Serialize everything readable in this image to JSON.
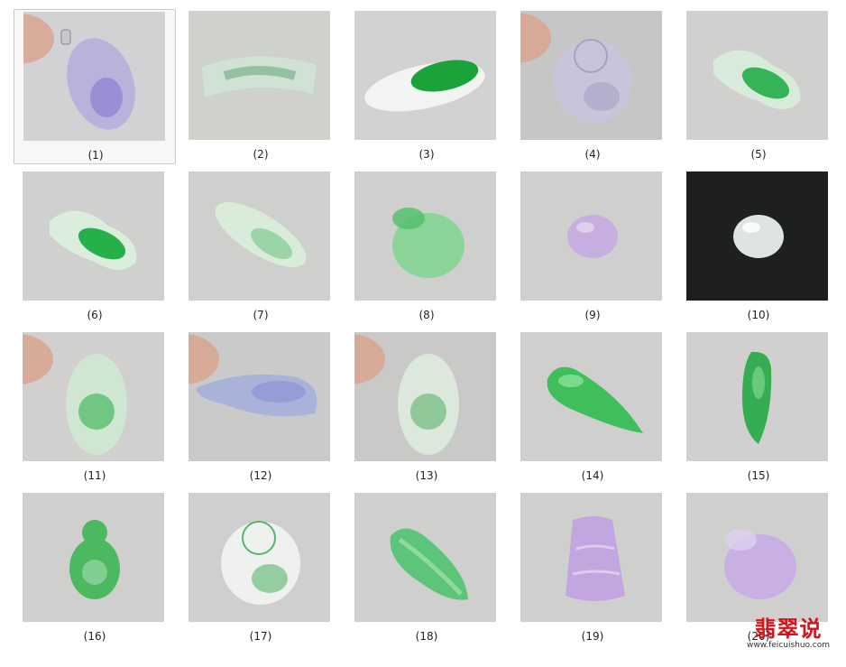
{
  "items": [
    {
      "caption": "(1)",
      "icon": "lavender-pendant-image",
      "bg": "#d2d2d4",
      "color": "#b9b3dc",
      "hl": "#8e7fd0",
      "shape": "pendant-bail",
      "hand": true,
      "selected": true
    },
    {
      "caption": "(2)",
      "icon": "green-bangle-bar-image",
      "bg": "#cfd1cd",
      "color": "#cfe2d4",
      "hl": "#7fb08d",
      "shape": "curved-bar",
      "hand": false,
      "selected": false
    },
    {
      "caption": "(3)",
      "icon": "green-carved-pendant-image",
      "bg": "#d2d2d2",
      "color": "#f2f4f1",
      "hl": "#1aa33a",
      "shape": "long-oval",
      "hand": false,
      "selected": false
    },
    {
      "caption": "(4)",
      "icon": "lavender-buddha-image",
      "bg": "#c7c6c6",
      "color": "#c9c4d9",
      "hl": "#a8a1c7",
      "shape": "round-buddha",
      "hand": true,
      "selected": false
    },
    {
      "caption": "(5)",
      "icon": "green-peapod-image",
      "bg": "#d0d0ce",
      "color": "#d8ead9",
      "hl": "#35b457",
      "shape": "peapod",
      "hand": false,
      "selected": false
    },
    {
      "caption": "(6)",
      "icon": "green-peapod-image",
      "bg": "#d0d0ce",
      "color": "#dbeedd",
      "hl": "#26b04a",
      "shape": "peapod",
      "hand": false,
      "selected": false
    },
    {
      "caption": "(7)",
      "icon": "green-carved-pendant-image",
      "bg": "#cfcfcd",
      "color": "#d9ecd9",
      "hl": "#72c487",
      "shape": "long-oval-tilt",
      "hand": false,
      "selected": false
    },
    {
      "caption": "(8)",
      "icon": "green-ruyi-pendant-image",
      "bg": "#cfcfcd",
      "color": "#8ad49a",
      "hl": "#4fbf68",
      "shape": "drop-round",
      "hand": false,
      "selected": false
    },
    {
      "caption": "(9)",
      "icon": "lavender-cabochon-image",
      "bg": "#cfcfce",
      "color": "#c7aee0",
      "hl": "#e4d8f0",
      "shape": "oval-small",
      "hand": false,
      "selected": false
    },
    {
      "caption": "(10)",
      "icon": "icy-cabochon-image",
      "bg": "#1d1f21",
      "color": "#dfe3e3",
      "hl": "#ffffff",
      "shape": "oval-small",
      "hand": false,
      "selected": false
    },
    {
      "caption": "(11)",
      "icon": "green-buddha-image",
      "bg": "#d1d0ce",
      "color": "#cfe6d2",
      "hl": "#48b95e",
      "shape": "tall-buddha",
      "hand": true,
      "selected": false
    },
    {
      "caption": "(12)",
      "icon": "lavender-carving-image",
      "bg": "#cacaca",
      "color": "#a9b2d9",
      "hl": "#8a8fd4",
      "shape": "long-horizontal",
      "hand": true,
      "selected": false
    },
    {
      "caption": "(13)",
      "icon": "green-carving-image",
      "bg": "#c9cac8",
      "color": "#dce8dc",
      "hl": "#6db97c",
      "shape": "tall-buddha",
      "hand": true,
      "selected": false
    },
    {
      "caption": "(14)",
      "icon": "green-teardrop-image",
      "bg": "#cfcfcd",
      "color": "#3fbf5c",
      "hl": "#8be29a",
      "shape": "teardrop",
      "hand": false,
      "selected": false
    },
    {
      "caption": "(15)",
      "icon": "green-pepper-pendant-image",
      "bg": "#d0d0ce",
      "color": "#35ad52",
      "hl": "#7fd690",
      "shape": "pepper",
      "hand": false,
      "selected": false
    },
    {
      "caption": "(16)",
      "icon": "green-small-buddha-image",
      "bg": "#cfcfcd",
      "color": "#4cb85f",
      "hl": "#8fd59c",
      "shape": "small-buddha",
      "hand": false,
      "selected": false
    },
    {
      "caption": "(17)",
      "icon": "white-green-buddha-image",
      "bg": "#cfcfcf",
      "color": "#eef1ee",
      "hl": "#58b56f",
      "shape": "round-buddha",
      "hand": false,
      "selected": false
    },
    {
      "caption": "(18)",
      "icon": "green-leaf-pendant-image",
      "bg": "#cfcfcd",
      "color": "#5cc57a",
      "hl": "#a4e2b2",
      "shape": "leaf",
      "hand": false,
      "selected": false
    },
    {
      "caption": "(19)",
      "icon": "lavender-bamboo-pendant-image",
      "bg": "#cfcfcd",
      "color": "#c2a6df",
      "hl": "#dccdf0",
      "shape": "bamboo",
      "hand": false,
      "selected": false
    },
    {
      "caption": "(20)",
      "icon": "lavender-drop-pendant-image",
      "bg": "#cfcfcd",
      "color": "#c9b0e4",
      "hl": "#dfd0f0",
      "shape": "drop-round",
      "hand": false,
      "selected": false
    }
  ],
  "watermark": {
    "title": "翡翠说",
    "url": "www.feicuishuo.com",
    "color": "#d2151b"
  }
}
